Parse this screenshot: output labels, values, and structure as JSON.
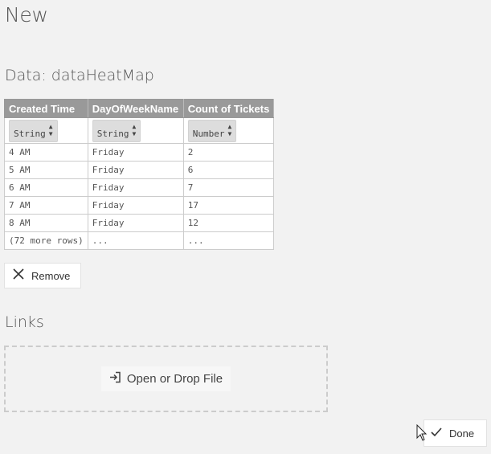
{
  "page": {
    "title": "New"
  },
  "data_section": {
    "heading": "Data: dataHeatMap",
    "columns": [
      {
        "name": "Created Time",
        "type": "String"
      },
      {
        "name": "DayOfWeekName",
        "type": "String"
      },
      {
        "name": "Count of Tickets",
        "type": "Number"
      }
    ],
    "rows": [
      [
        "4 AM",
        "Friday",
        "2"
      ],
      [
        "5 AM",
        "Friday",
        "6"
      ],
      [
        "6 AM",
        "Friday",
        "7"
      ],
      [
        "7 AM",
        "Friday",
        "17"
      ],
      [
        "8 AM",
        "Friday",
        "12"
      ],
      [
        "(72 more rows)",
        "...",
        "..."
      ]
    ],
    "remove_label": "Remove"
  },
  "links_section": {
    "heading": "Links",
    "open_file_label": "Open or Drop File"
  },
  "footer": {
    "done_label": "Done"
  },
  "icons": {
    "remove": "close-icon",
    "sort": "sort-icon",
    "open_file": "file-import-icon",
    "done": "check-icon",
    "cursor": "mouse-pointer-icon"
  }
}
